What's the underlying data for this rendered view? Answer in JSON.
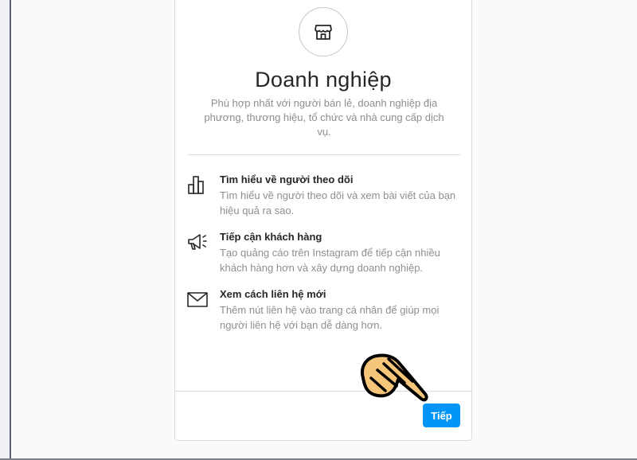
{
  "page": {
    "title": "Doanh nghiệp",
    "subtitle": "Phù hợp nhất với người bán lẻ, doanh nghiệp địa phương, thương hiệu, tổ chức và nhà cung cấp dịch vụ.",
    "icon": "store-icon"
  },
  "features": [
    {
      "icon": "bar-chart-icon",
      "title": "Tìm hiểu về người theo dõi",
      "description": "Tìm hiểu về người theo dõi và xem bài viết của bạn hiệu quả ra sao."
    },
    {
      "icon": "megaphone-icon",
      "title": "Tiếp cận khách hàng",
      "description": "Tạo quảng cáo trên Instagram để tiếp cận nhiều khách hàng hơn và xây dựng doanh nghiệp."
    },
    {
      "icon": "mail-icon",
      "title": "Xem cách liên hệ mới",
      "description": "Thêm nút liên hệ vào trang cá nhân để giúp mọi người liên hệ với bạn dễ dàng hơn."
    }
  ],
  "footer": {
    "next_label": "Tiếp"
  },
  "annotation": {
    "icon": "pointing-hand-icon"
  },
  "colors": {
    "accent": "#0095f6",
    "text": "#262626",
    "muted": "#8e8e8e",
    "border": "#dbdbdb",
    "hand": "#f5c57a"
  }
}
